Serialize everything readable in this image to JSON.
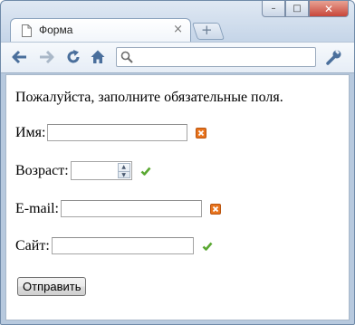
{
  "browser": {
    "tab_title": "Форма",
    "tab_close": "×",
    "new_tab": "+",
    "window_buttons": {
      "minimize": "–",
      "maximize": "□",
      "close": "✕"
    },
    "toolbar": {
      "back_icon": "back-arrow-icon",
      "forward_icon": "forward-arrow-icon",
      "reload_icon": "reload-icon",
      "home_icon": "home-icon",
      "search_icon": "search-icon",
      "menu_icon": "wrench-icon",
      "address_value": ""
    }
  },
  "form": {
    "intro": "Пожалуйста, заполните обязательные поля.",
    "fields": [
      {
        "label": "Имя:",
        "value": "",
        "status": "invalid"
      },
      {
        "label": "Возраст:",
        "value": "",
        "status": "valid"
      },
      {
        "label": "E-mail:",
        "value": "",
        "status": "invalid"
      },
      {
        "label": "Сайт:",
        "value": "",
        "status": "valid"
      }
    ],
    "submit_label": "Отправить"
  },
  "colors": {
    "invalid": "#e8731c",
    "valid": "#5aa832",
    "accent": "#4a6f9c"
  }
}
